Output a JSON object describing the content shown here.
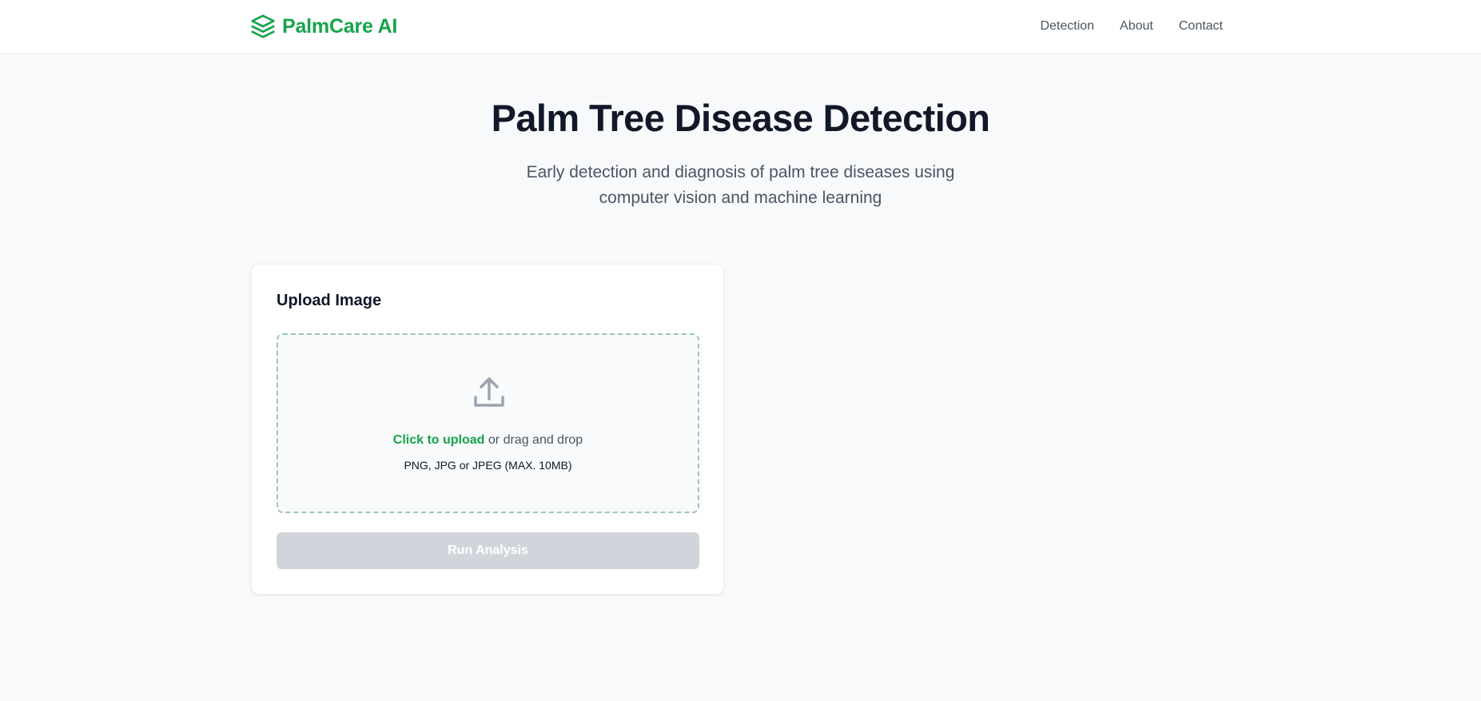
{
  "brand": {
    "name": "PalmCare AI",
    "icon": "layers-icon",
    "color": "#16a34a"
  },
  "nav": {
    "links": [
      {
        "label": "Detection"
      },
      {
        "label": "About"
      },
      {
        "label": "Contact"
      }
    ]
  },
  "hero": {
    "title": "Palm Tree Disease Detection",
    "subtitle": "Early detection and diagnosis of palm tree diseases using computer vision and machine learning"
  },
  "upload_card": {
    "title": "Upload Image",
    "dropzone": {
      "icon": "upload-icon",
      "link_text": "Click to upload",
      "rest_text": " or drag and drop",
      "hint": "PNG, JPG or JPEG (MAX. 10MB)"
    },
    "button_label": "Run Analysis",
    "button_state": "disabled"
  },
  "colors": {
    "accent": "#16a34a",
    "background": "#f8f9fb",
    "button_disabled": "#d1d5db"
  }
}
